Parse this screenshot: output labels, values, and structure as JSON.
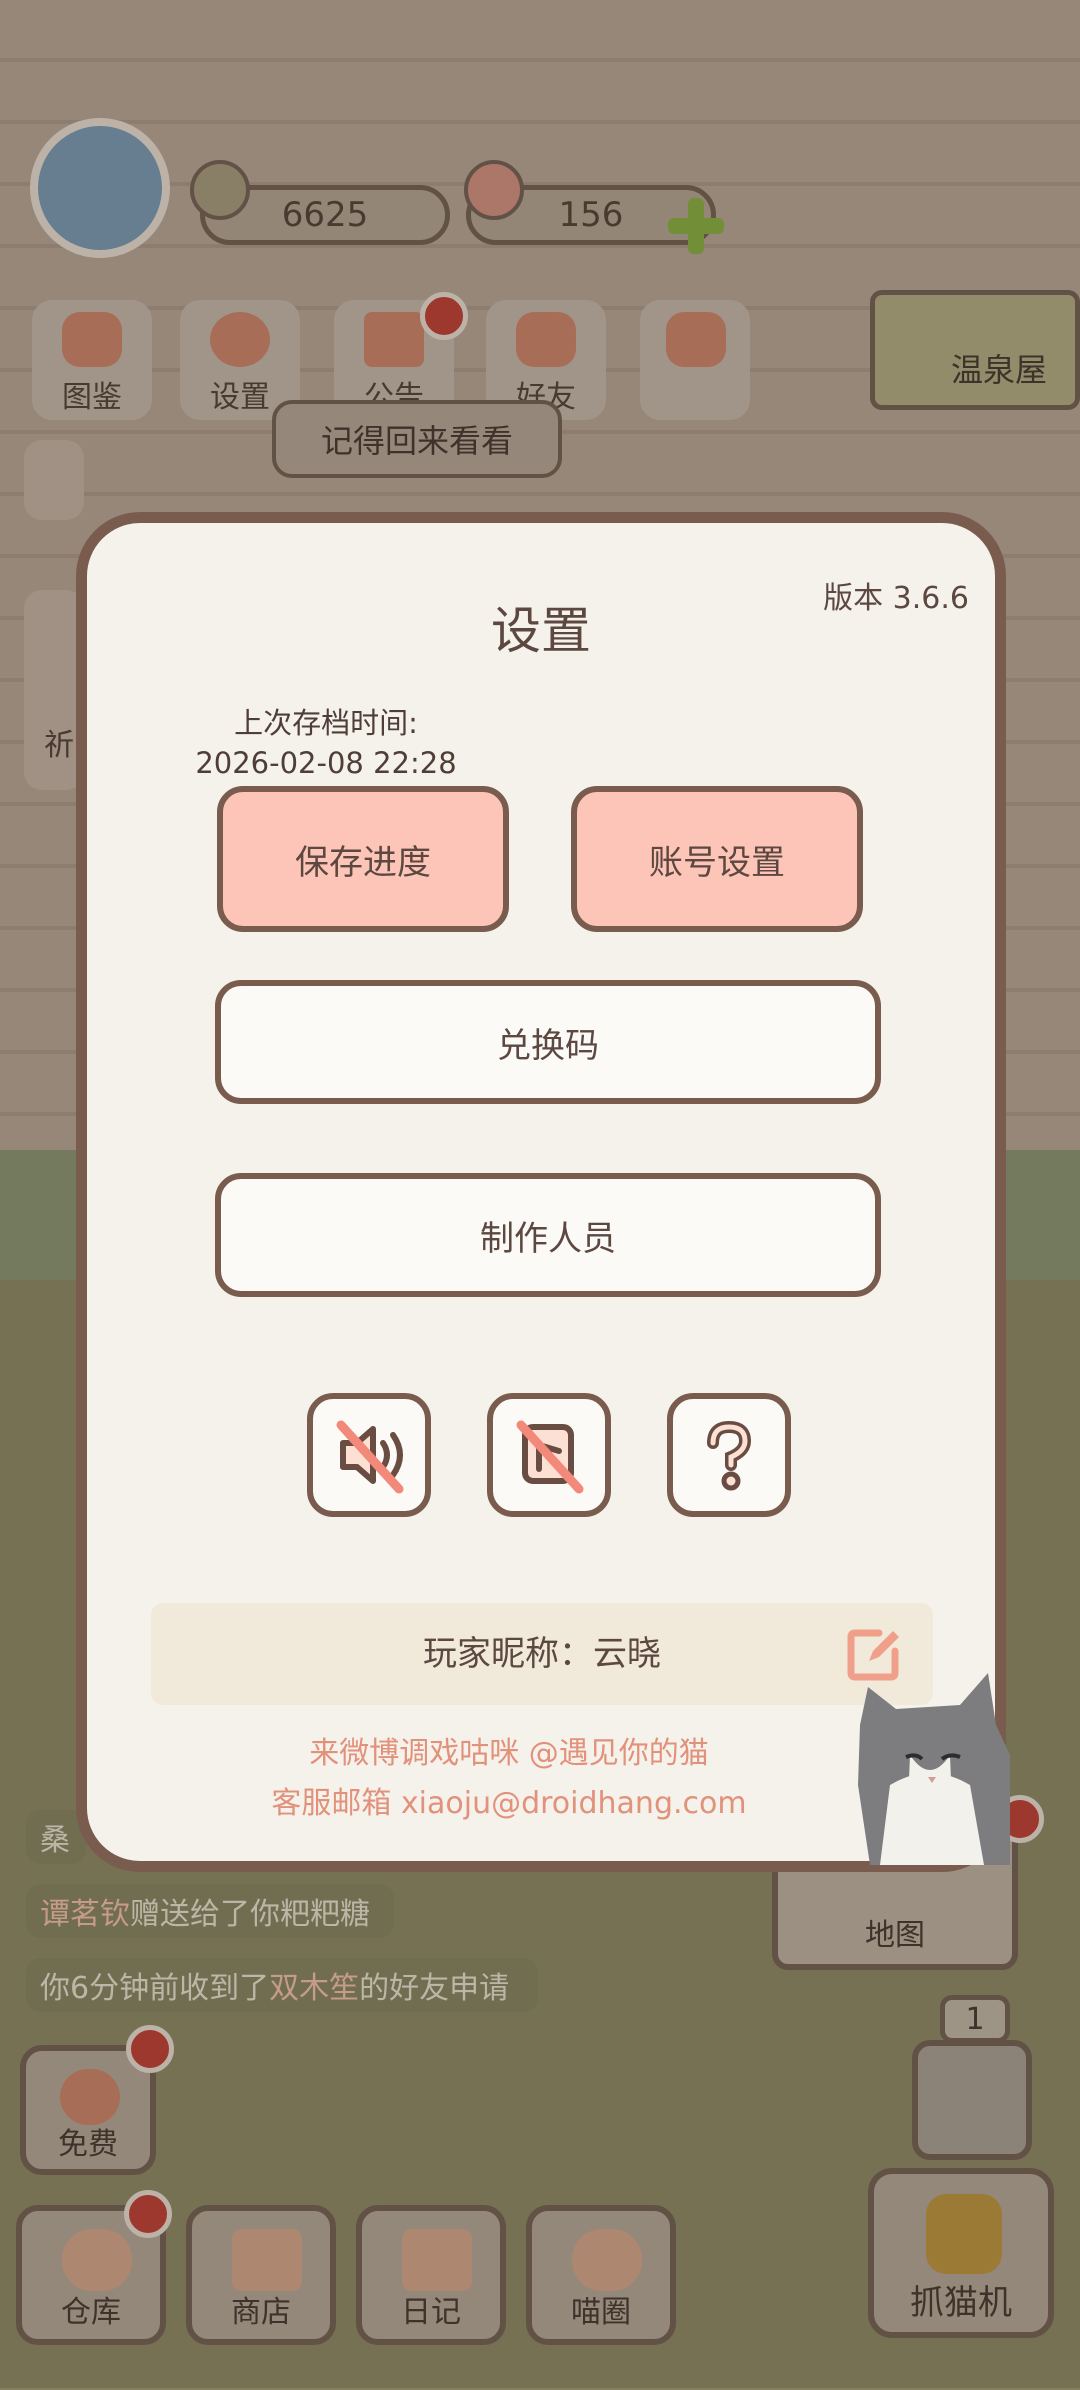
{
  "hud": {
    "fish_count": "6625",
    "gem_count": "156"
  },
  "top_menu": [
    {
      "label": "图鉴"
    },
    {
      "label": "设置"
    },
    {
      "label": "公告"
    },
    {
      "label": "好友"
    }
  ],
  "tooltip": "记得回来看看",
  "hotspring_label": "温泉屋",
  "side_left_partial": "祈",
  "chat": [
    {
      "prefix": "桑",
      "rest": ""
    },
    {
      "name": "谭茗钦",
      "rest": "赠送给了你粑粑糖"
    },
    {
      "prefix": "你6分钟前收到了",
      "name": "双木笙",
      "rest": "的好友申请"
    }
  ],
  "map_label": "地图",
  "slot_counter": "1",
  "free_label": "免费",
  "bottom_nav": [
    {
      "label": "仓库"
    },
    {
      "label": "商店"
    },
    {
      "label": "日记"
    },
    {
      "label": "喵圈"
    }
  ],
  "claw_label": "抓猫机",
  "settings": {
    "title": "设置",
    "version": "版本 3.6.6",
    "last_save_label": "上次存档时间:",
    "last_save_time": "2026-02-08 22:28",
    "save_button": "保存进度",
    "account_button": "账号设置",
    "redeem_button": "兑换码",
    "credits_button": "制作人员",
    "nickname": "玩家昵称：云晓",
    "weibo_text": "来微博调戏咕咪 @遇见你的猫",
    "support_text": "客服邮箱 xiaoju@droidhang.com"
  },
  "colors": {
    "accent_pink": "#fdc5b8",
    "border_brown": "#7a5c4f",
    "footer_text": "#e2917b"
  }
}
